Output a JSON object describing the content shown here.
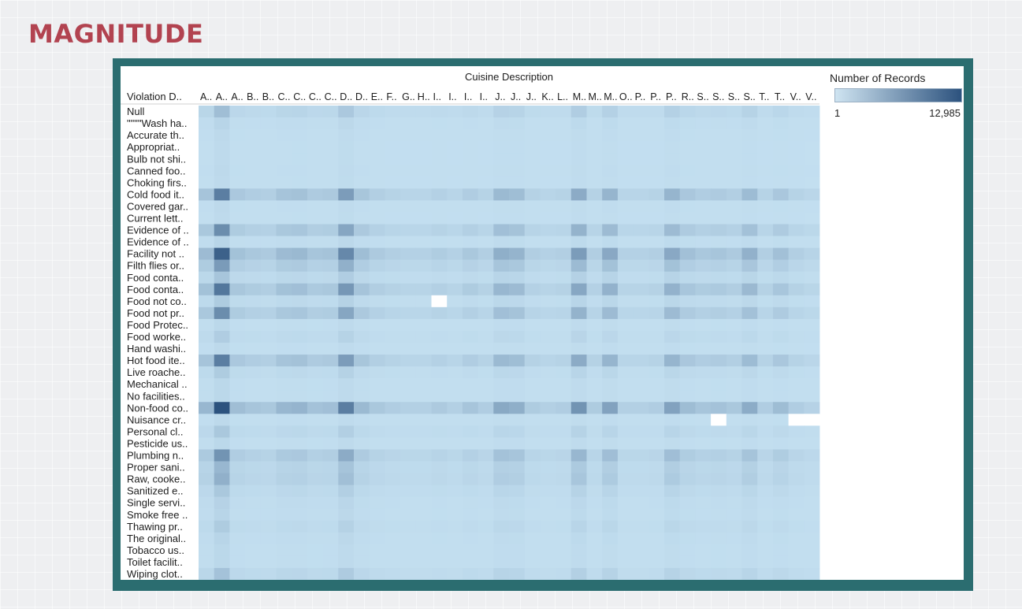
{
  "slide": {
    "title": "MAGNITUDE"
  },
  "chart_data": {
    "type": "heatmap",
    "title": "",
    "x_title": "Cuisine Description",
    "y_title": "Violation D..",
    "x_categories": [
      "A..",
      "A..",
      "A..",
      "B..",
      "B..",
      "C..",
      "C..",
      "C..",
      "C..",
      "D..",
      "D..",
      "E..",
      "F..",
      "G..",
      "H..",
      "I..",
      "I..",
      "I..",
      "I..",
      "J..",
      "J..",
      "J..",
      "K..",
      "L..",
      "M..",
      "M..",
      "M..",
      "O..",
      "P..",
      "P..",
      "P..",
      "R..",
      "S..",
      "S..",
      "S..",
      "S..",
      "T..",
      "T..",
      "V..",
      "V.."
    ],
    "y_categories": [
      "Null",
      "\"\"\"\"Wash ha..",
      "Accurate th..",
      "Appropriat..",
      "Bulb not shi..",
      "Canned foo..",
      "Choking firs..",
      "Cold food it..",
      "Covered gar..",
      "Current lett..",
      "Evidence of ..",
      "Evidence of ..",
      "Facility not ..",
      "Filth flies or..",
      "Food conta..",
      "Food conta..",
      "Food not co..",
      "Food not pr..",
      "Food Protec..",
      "Food worke..",
      "Hand washi..",
      "Hot food ite..",
      "Live roache..",
      "Mechanical ..",
      "No facilities..",
      "Non-food co..",
      "Nuisance cr..",
      "Personal cl..",
      "Pesticide us..",
      "Plumbing n..",
      "Proper sani..",
      "Raw, cooke..",
      "Sanitized e..",
      "Single servi..",
      "Smoke free ..",
      "Thawing pr..",
      "The original..",
      "Tobacco us..",
      "Toilet facilit..",
      "Wiping clot.."
    ],
    "color_scale": {
      "label": "Number of Records",
      "min": 1,
      "max": 12985,
      "min_label": "1",
      "max_label": "12,985",
      "low_color": "#c3dff0",
      "high_color": "#2c527e"
    },
    "column_weight": [
      0.3,
      1.0,
      0.25,
      0.2,
      0.18,
      0.3,
      0.32,
      0.22,
      0.24,
      0.7,
      0.28,
      0.18,
      0.14,
      0.12,
      0.12,
      0.16,
      0.12,
      0.2,
      0.14,
      0.4,
      0.36,
      0.15,
      0.12,
      0.14,
      0.55,
      0.15,
      0.45,
      0.12,
      0.12,
      0.14,
      0.45,
      0.26,
      0.2,
      0.22,
      0.18,
      0.38,
      0.14,
      0.26,
      0.14,
      0.1
    ],
    "row_weight": [
      0.25,
      0.08,
      0.05,
      0.04,
      0.04,
      0.05,
      0.04,
      0.7,
      0.05,
      0.04,
      0.6,
      0.08,
      0.9,
      0.5,
      0.2,
      0.75,
      0.15,
      0.6,
      0.06,
      0.14,
      0.05,
      0.7,
      0.15,
      0.06,
      0.06,
      1.0,
      0.05,
      0.18,
      0.06,
      0.55,
      0.3,
      0.35,
      0.18,
      0.1,
      0.08,
      0.15,
      0.08,
      0.06,
      0.06,
      0.22
    ],
    "missing_cells": [
      [
        16,
        15
      ],
      [
        26,
        33
      ],
      [
        26,
        38
      ],
      [
        26,
        39
      ]
    ],
    "grid": false,
    "legend_position": "right"
  }
}
